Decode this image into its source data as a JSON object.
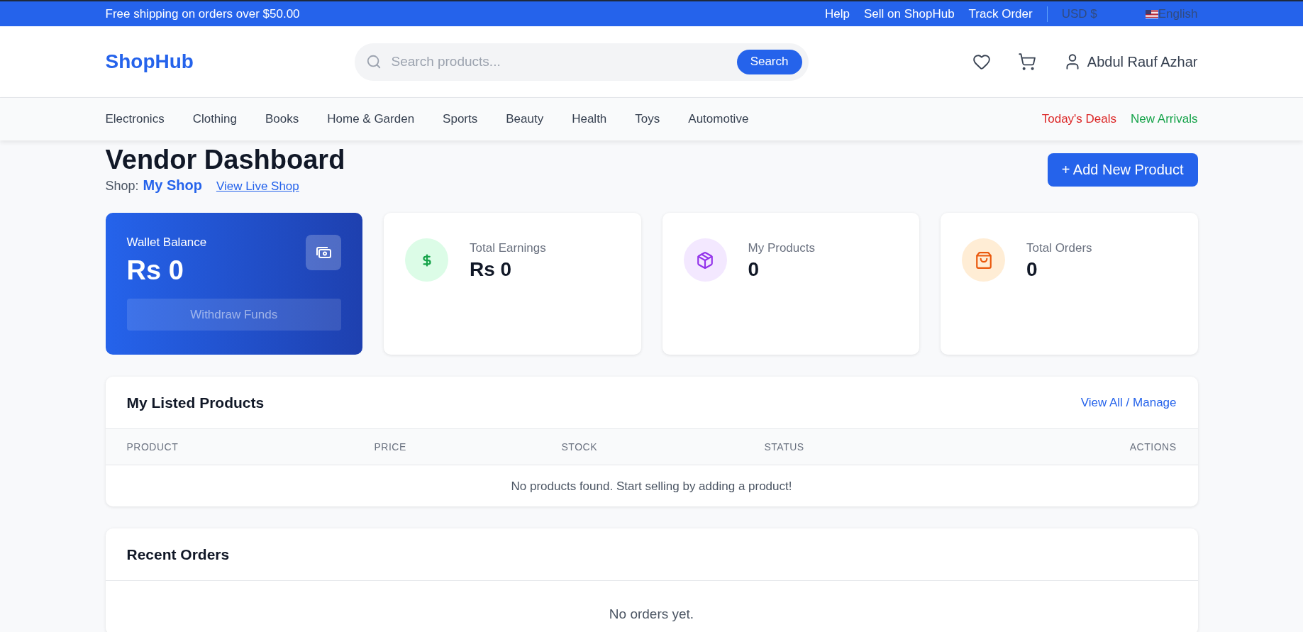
{
  "top_bar": {
    "promo": "Free shipping on orders over $50.00",
    "links": [
      "Help",
      "Sell on ShopHub",
      "Track Order"
    ],
    "currency": "USD $",
    "language": "English"
  },
  "header": {
    "logo": "ShopHub",
    "search": {
      "placeholder": "Search products...",
      "button": "Search"
    },
    "user_name": "Abdul Rauf Azhar"
  },
  "nav": {
    "categories": [
      "Electronics",
      "Clothing",
      "Books",
      "Home & Garden",
      "Sports",
      "Beauty",
      "Health",
      "Toys",
      "Automotive"
    ],
    "promos": [
      {
        "label": "Today's Deals",
        "color": "#dc2626"
      },
      {
        "label": "New Arrivals",
        "color": "#16a34a"
      }
    ]
  },
  "page": {
    "title": "Vendor Dashboard",
    "shop_label": "Shop:",
    "shop_name": "My Shop",
    "view_link": "View Live Shop",
    "add_button": "+ Add New Product"
  },
  "stats": [
    {
      "kind": "wallet",
      "label": "Wallet Balance",
      "value": "Rs 0",
      "button": "Withdraw Funds"
    },
    {
      "kind": "earnings",
      "label": "Total Earnings",
      "value": "Rs 0"
    },
    {
      "kind": "products",
      "label": "My Products",
      "value": "0"
    },
    {
      "kind": "orders",
      "label": "Total Orders",
      "value": "0"
    }
  ],
  "products": {
    "title": "My Listed Products",
    "link": "View All / Manage",
    "columns": [
      "PRODUCT",
      "PRICE",
      "STOCK",
      "STATUS",
      "ACTIONS"
    ],
    "empty_message": "No products found. Start selling by adding a product!"
  },
  "orders": {
    "title": "Recent Orders",
    "empty_message": "No orders yet."
  }
}
